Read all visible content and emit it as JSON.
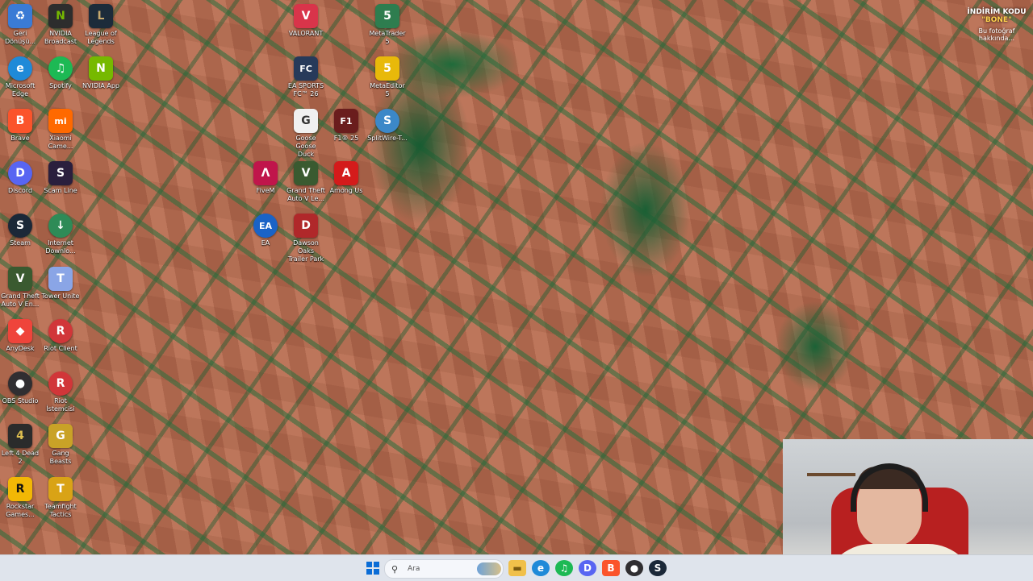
{
  "desktop": {
    "icons": [
      {
        "label": "Geri\nDönüşü...",
        "glyph": "♻",
        "color": "#3a7bd5"
      },
      {
        "label": "NVIDIA\nBroadcast",
        "glyph": "N",
        "color": "#2d2d2d"
      },
      {
        "label": "League of\nLegends",
        "glyph": "L",
        "color": "#1c2b3a"
      },
      {
        "label": "VALORANT",
        "glyph": "V",
        "color": "#d9344a"
      },
      {
        "label": "MetaTrader 5",
        "glyph": "5",
        "color": "#2e7d4f"
      },
      {
        "label": "Microsoft\nEdge",
        "glyph": "e",
        "color": "#1f8ad8"
      },
      {
        "label": "Spotify",
        "glyph": "♫",
        "color": "#1db954"
      },
      {
        "label": "NVIDIA App",
        "glyph": "N",
        "color": "#76b900"
      },
      {
        "label": "EA SPORTS\nFC™ 26",
        "glyph": "FC",
        "color": "#273a5a"
      },
      {
        "label": "MetaEditor 5",
        "glyph": "5",
        "color": "#e8b90a"
      },
      {
        "label": "Brave",
        "glyph": "B",
        "color": "#fb542b"
      },
      {
        "label": "Xiaomi\nCame...",
        "glyph": "mi",
        "color": "#ff6900"
      },
      {
        "label": "Goose Goose\nDuck",
        "glyph": "G",
        "color": "#f0f0f0"
      },
      {
        "label": "F1® 25",
        "glyph": "F1",
        "color": "#6a1d1d"
      },
      {
        "label": "SplitWire-T...",
        "glyph": "S",
        "color": "#3c88c8"
      },
      {
        "label": "Discord",
        "glyph": "D",
        "color": "#5865f2"
      },
      {
        "label": "Scam Line",
        "glyph": "S",
        "color": "#2a1f3d"
      },
      {
        "label": "FiveM",
        "glyph": "Λ",
        "color": "#c0154b"
      },
      {
        "label": "Grand Theft\nAuto V Le...",
        "glyph": "V",
        "color": "#3a5a30"
      },
      {
        "label": "Among Us",
        "glyph": "A",
        "color": "#d41b1b"
      },
      {
        "label": "Steam",
        "glyph": "S",
        "color": "#1b2838"
      },
      {
        "label": "Internet\nDownlo...",
        "glyph": "↓",
        "color": "#2e8b57"
      },
      {
        "label": "EA",
        "glyph": "EA",
        "color": "#1a63c7"
      },
      {
        "label": "Dawson Oaks\nTrailer Park",
        "glyph": "D",
        "color": "#b0282a"
      },
      {
        "label": "Grand Theft\nAuto V En...",
        "glyph": "V",
        "color": "#3a5a30"
      },
      {
        "label": "Tower Unite",
        "glyph": "T",
        "color": "#8aa5e6"
      },
      {
        "label": "AnyDesk",
        "glyph": "◆",
        "color": "#ef443b"
      },
      {
        "label": "Riot Client",
        "glyph": "R",
        "color": "#d13639"
      },
      {
        "label": "OBS Studio",
        "glyph": "●",
        "color": "#302e31"
      },
      {
        "label": "Riot İstemcisi",
        "glyph": "R",
        "color": "#d13639"
      },
      {
        "label": "Left 4 Dead 2",
        "glyph": "4",
        "color": "#2b2b2b"
      },
      {
        "label": "Gang Beasts",
        "glyph": "G",
        "color": "#c9a227"
      },
      {
        "label": "Rockstar\nGames...",
        "glyph": "R",
        "color": "#f2b705"
      },
      {
        "label": "Teamfight\nTactics",
        "glyph": "T",
        "color": "#d9a316"
      }
    ]
  },
  "promo": {
    "line1": "İNDİRİM KODU",
    "line2": "\"BONE\"",
    "line3": "Bu fotoğraf",
    "line4": "hakkında..."
  },
  "taskbar": {
    "search_placeholder": "Ara"
  }
}
